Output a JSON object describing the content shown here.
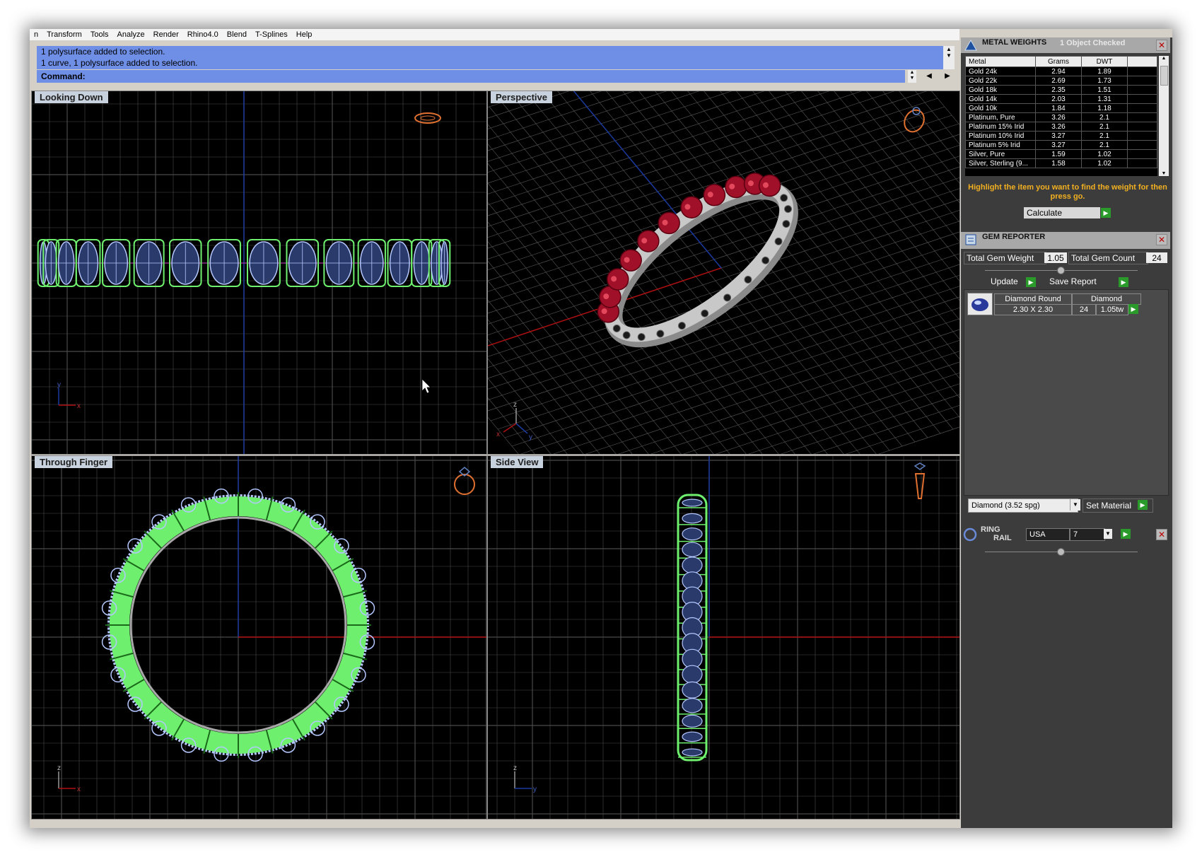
{
  "menu": [
    "n",
    "Transform",
    "Tools",
    "Analyze",
    "Render",
    "Rhino4.0",
    "Blend",
    "T-Splines",
    "Help"
  ],
  "history": [
    "1 polysurface added to selection.",
    "1 curve, 1 polysurface added to selection."
  ],
  "command_label": "Command:",
  "viewports": {
    "top": "Looking Down",
    "perspective": "Perspective",
    "front": "Through Finger",
    "side": "Side View"
  },
  "axes": {
    "top_y": "y",
    "top_x": "x",
    "persp_z": "z",
    "persp_x": "x",
    "persp_y": "y",
    "front_z": "z",
    "front_x": "x",
    "side_z": "z",
    "side_y": "y"
  },
  "metal_weights": {
    "title": "METAL WEIGHTS",
    "status": "1 Object Checked",
    "columns": [
      "Metal",
      "Grams",
      "DWT"
    ],
    "rows": [
      [
        "Gold 24k",
        "2.94",
        "1.89"
      ],
      [
        "Gold 22k",
        "2.69",
        "1.73"
      ],
      [
        "Gold 18k",
        "2.35",
        "1.51"
      ],
      [
        "Gold 14k",
        "2.03",
        "1.31"
      ],
      [
        "Gold 10k",
        "1.84",
        "1.18"
      ],
      [
        "Platinum, Pure",
        "3.26",
        "2.1"
      ],
      [
        "Platinum 15% Irid",
        "3.26",
        "2.1"
      ],
      [
        "Platinum 10% Irid",
        "3.27",
        "2.1"
      ],
      [
        "Platinum 5% Irid",
        "3.27",
        "2.1"
      ],
      [
        "Silver, Pure",
        "1.59",
        "1.02"
      ],
      [
        "Silver, Sterling (9...",
        "1.58",
        "1.02"
      ]
    ],
    "hint": "Highlight the item you want to find the weight for then press go.",
    "calculate": "Calculate"
  },
  "gem_reporter": {
    "title": "GEM REPORTER",
    "total_weight_label": "Total Gem Weight",
    "total_weight": "1.05",
    "total_count_label": "Total Gem Count",
    "total_count": "24",
    "update": "Update",
    "save_report": "Save Report",
    "gem_shape": "Diamond Round",
    "gem_size": "2.30 X 2.30",
    "gem_type": "Diamond",
    "gem_qty": "24",
    "gem_tw": "1.05tw",
    "material": "Diamond     (3.52 spg)",
    "set_material": "Set Material"
  },
  "ring_rail": {
    "title_line1": "RING",
    "title_line2": "RAIL",
    "standard": "USA",
    "size": "7"
  },
  "colors": {
    "background": "#000000",
    "grid": "#4a4a4a",
    "wire_green": "#6ef06e",
    "wire_blue": "#b4c8ff",
    "ruby": "#a01028",
    "metal": "#c8c8c8",
    "axis_red": "#b01010",
    "axis_blue": "#1a3aa0",
    "history_bg": "#6f8fe6"
  }
}
